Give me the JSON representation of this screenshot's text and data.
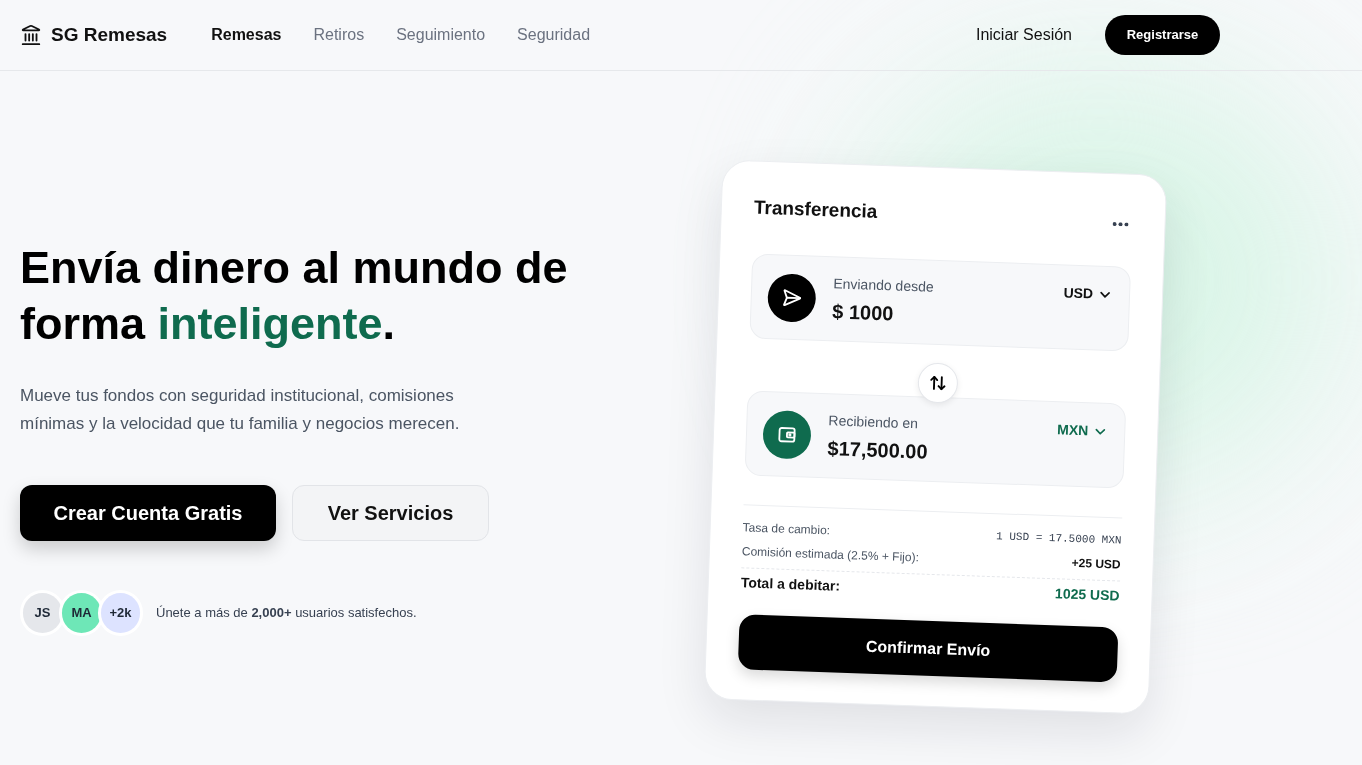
{
  "nav": {
    "brand": "SG Remesas",
    "links": [
      {
        "label": "Remesas",
        "selected": true
      },
      {
        "label": "Retiros",
        "selected": false
      },
      {
        "label": "Seguimiento",
        "selected": false
      },
      {
        "label": "Seguridad",
        "selected": false
      }
    ],
    "login": "Iniciar Sesión",
    "signup": "Registrarse"
  },
  "hero": {
    "title_start": "Envía dinero al mundo de forma ",
    "title_accent": "inteligente",
    "title_end": ".",
    "subtitle": "Mueve tus fondos con seguridad institucional, comisiones mínimas y la velocidad que tu familia y negocios merecen.",
    "buttons": [
      {
        "label": "Crear Cuenta Gratis",
        "kind": "primary"
      },
      {
        "label": "Ver Servicios",
        "kind": "secondary"
      }
    ],
    "social_proof": {
      "avatars": [
        {
          "initials": "JS",
          "color": "#e5e7eb"
        },
        {
          "initials": "MA",
          "color": "#6ee7b7"
        },
        {
          "initials": "+2k",
          "color": "#dde3ff"
        }
      ],
      "text": "Únete a más de **2,000+** usuarios satisfechos."
    }
  },
  "card": {
    "title": "Transferencia",
    "send": {
      "label": "Enviando desde",
      "amount": "$ 1000",
      "currency": "USD"
    },
    "receive": {
      "label": "Recibiendo en",
      "amount": "$17,500.00",
      "currency": "MXN"
    },
    "details": [
      {
        "kind": "rate",
        "label": "Tasa de cambio:",
        "value": "1 USD = 17.5000 MXN"
      },
      {
        "kind": "fee",
        "label": "Comisión estimada (2.5% + Fijo):",
        "value": "+25 USD"
      },
      {
        "kind": "total",
        "label": "Total a debitar:",
        "value": "1025 USD"
      }
    ],
    "confirm": "Confirmar Envío"
  }
}
